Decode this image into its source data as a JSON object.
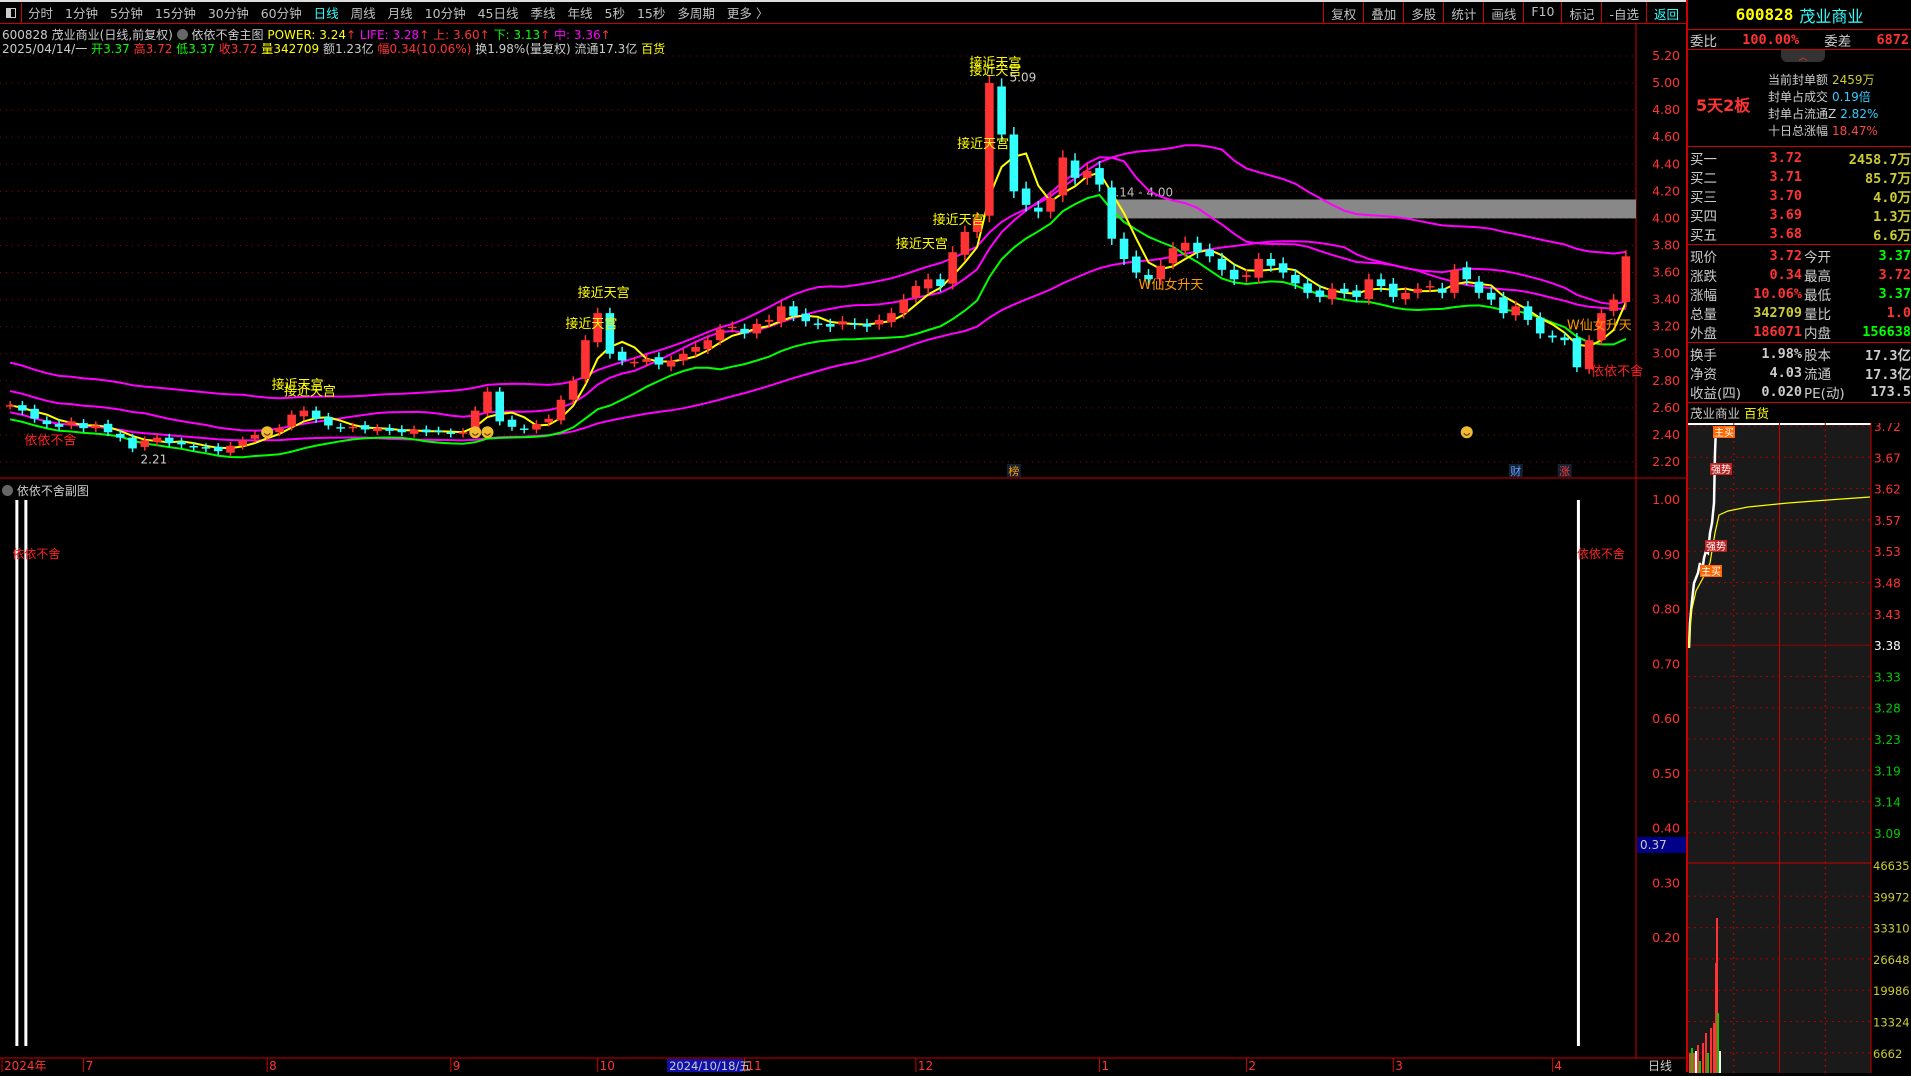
{
  "toolbar": {
    "periods": [
      "分时",
      "1分钟",
      "5分钟",
      "15分钟",
      "30分钟",
      "60分钟",
      "日线",
      "周线",
      "月线",
      "10分钟",
      "45日线",
      "季线",
      "年线",
      "5秒",
      "15秒",
      "多周期",
      "更多 〉"
    ],
    "active": "日线",
    "tools": [
      "复权",
      "叠加",
      "多股",
      "统计",
      "画线",
      "F10",
      "标记",
      "-自选",
      "返回"
    ]
  },
  "header": {
    "code": "600828",
    "name": "茂业商业(日线,前复权)",
    "indicator": "依依不舍主图",
    "power": "POWER: 3.24",
    "life": "LIFE: 3.28",
    "up": "上: 3.60",
    "down": "下: 3.13",
    "mid": "中: 3.36",
    "date": "2025/04/14/一",
    "open_l": "开",
    "open": "3.37",
    "high_l": "高",
    "high": "3.72",
    "low_l": "低",
    "low": "3.37",
    "close_l": "收",
    "close": "3.72",
    "vol_l": "量",
    "vol": "342709",
    "amt": "额1.23亿",
    "chg_l": "幅",
    "chg": "0.34(10.06%)",
    "turn": "换1.98%(量复权)",
    "float": "流通17.3亿",
    "sector": "百货"
  },
  "chart_data": {
    "type": "candlestick",
    "closes": [
      2.62,
      2.58,
      2.52,
      2.48,
      2.46,
      2.5,
      2.45,
      2.47,
      2.42,
      2.38,
      2.3,
      2.36,
      2.38,
      2.34,
      2.33,
      2.31,
      2.3,
      2.28,
      2.32,
      2.36,
      2.4,
      2.42,
      2.45,
      2.55,
      2.58,
      2.52,
      2.47,
      2.45,
      2.46,
      2.44,
      2.45,
      2.43,
      2.42,
      2.44,
      2.42,
      2.43,
      2.41,
      2.42,
      2.58,
      2.72,
      2.5,
      2.46,
      2.44,
      2.48,
      2.52,
      2.66,
      2.8,
      3.1,
      3.3,
      3.0,
      2.95,
      2.94,
      2.96,
      2.92,
      2.95,
      3.0,
      3.05,
      3.1,
      3.18,
      3.2,
      3.15,
      3.22,
      3.25,
      3.35,
      3.28,
      3.24,
      3.22,
      3.2,
      3.24,
      3.22,
      3.2,
      3.25,
      3.3,
      3.4,
      3.5,
      3.55,
      3.5,
      3.75,
      3.9,
      4.0,
      5.0,
      4.62,
      4.2,
      4.1,
      4.05,
      4.15,
      4.45,
      4.3,
      4.35,
      4.25,
      3.85,
      3.7,
      3.6,
      3.55,
      3.65,
      3.78,
      3.82,
      3.75,
      3.72,
      3.62,
      3.55,
      3.58,
      3.7,
      3.65,
      3.6,
      3.52,
      3.45,
      3.42,
      3.48,
      3.45,
      3.42,
      3.55,
      3.5,
      3.42,
      3.45,
      3.48,
      3.5,
      3.45,
      3.62,
      3.55,
      3.45,
      3.4,
      3.3,
      3.35,
      3.25,
      3.15,
      3.12,
      3.1,
      2.9,
      3.1,
      3.3,
      3.4,
      3.72
    ],
    "ylim": [
      2.2,
      5.2
    ],
    "yticks": [
      "5.20",
      "5.00",
      "4.80",
      "4.60",
      "4.40",
      "4.20",
      "4.00",
      "3.80",
      "3.60",
      "3.40",
      "3.20",
      "3.00",
      "2.80",
      "2.60",
      "2.40",
      "2.20"
    ],
    "colors": {
      "up": "#ff3333",
      "down": "#33ffff",
      "ma": "#ffff00",
      "low": "#00ff00",
      "band": "#ff00ff"
    },
    "xticks": [
      {
        "label": "2024年",
        "bar": 0
      },
      {
        "label": "7",
        "bar": 6
      },
      {
        "label": "8",
        "bar": 21
      },
      {
        "label": "9",
        "bar": 36
      },
      {
        "label": "10",
        "bar": 48
      },
      {
        "label": "11",
        "bar": 60
      },
      {
        "label": "12",
        "bar": 74
      },
      {
        "label": "1",
        "bar": 89
      },
      {
        "label": "2",
        "bar": 101
      },
      {
        "label": "3",
        "bar": 113
      },
      {
        "label": "4",
        "bar": 126
      }
    ],
    "cursor_date": "2024/10/18/五",
    "annotations": [
      {
        "t": "接近天宫",
        "bar": 48,
        "p": 3.42
      },
      {
        "t": "接近天宫",
        "bar": 47,
        "p": 3.19
      },
      {
        "t": "接近天宫",
        "bar": 23,
        "p": 2.74
      },
      {
        "t": "接近天宫",
        "bar": 24,
        "p": 2.69
      },
      {
        "t": "接近天宫",
        "bar": 74,
        "p": 3.78
      },
      {
        "t": "接近天宫",
        "bar": 77,
        "p": 3.96
      },
      {
        "t": "接近天宫",
        "bar": 79,
        "p": 4.52
      },
      {
        "t": "接近天宫",
        "bar": 80,
        "p": 5.12
      },
      {
        "t": "接近天宫",
        "bar": 80,
        "p": 5.06
      }
    ],
    "w_labels": [
      {
        "t": "W仙女升天",
        "bar": 93,
        "p": 3.48
      },
      {
        "t": "W仙女升天",
        "bar": 128,
        "p": 3.18
      }
    ],
    "yiyi_labels": [
      {
        "t": "依依不舍",
        "bar": 1,
        "p": 2.33
      },
      {
        "t": "依依不舍",
        "bar": 129,
        "p": 2.84
      }
    ],
    "price_labels": [
      {
        "t": "5.09",
        "bar": 81,
        "p": 5.04
      },
      {
        "t": "2.21",
        "bar": 10,
        "p": 2.22
      }
    ],
    "zone": {
      "label": "4.14 - 4.00",
      "from": 4.0,
      "to": 4.14,
      "bar": 90
    },
    "smileys": [
      21,
      38,
      39,
      119
    ],
    "markers": [
      {
        "t": "榜",
        "bar": 82,
        "color": "#f90"
      },
      {
        "t": "财",
        "bar": 123,
        "color": "#69f"
      },
      {
        "t": "涨",
        "bar": 127,
        "color": "#f33"
      }
    ]
  },
  "sub": {
    "title": "依依不舍副图",
    "yticks": [
      "1.00",
      "0.90",
      "0.80",
      "0.70",
      "0.60",
      "0.50",
      "0.40",
      "0.30",
      "0.20"
    ],
    "cursor": "0.37",
    "signal": "依依不舍"
  },
  "axis_mode": "日线",
  "panel": {
    "code": "600828",
    "name": "茂业商业",
    "wb_l": "委比",
    "wb": "100.00%",
    "wc_l": "委差",
    "wc": "6872",
    "board": "5天2板",
    "seal": [
      {
        "k": "当前封单额",
        "v": "2459万",
        "c": "#cc3"
      },
      {
        "k": "封单占成交",
        "v": "0.19倍",
        "c": "#3cf"
      },
      {
        "k": "封单占流通Z",
        "v": "2.82%",
        "c": "#3cf"
      },
      {
        "k": "十日总涨幅",
        "v": "18.47%",
        "c": "#f44"
      }
    ],
    "bids": [
      {
        "k": "买一",
        "p": "3.72",
        "v": "2458.7万"
      },
      {
        "k": "买二",
        "p": "3.71",
        "v": "85.7万"
      },
      {
        "k": "买三",
        "p": "3.70",
        "v": "4.0万"
      },
      {
        "k": "买四",
        "p": "3.69",
        "v": "1.3万"
      },
      {
        "k": "买五",
        "p": "3.68",
        "v": "6.6万"
      }
    ],
    "quote": [
      {
        "a": "现价",
        "av": "3.72",
        "ac": "#f33",
        "b": "今开",
        "bv": "3.37",
        "bc": "#0f0"
      },
      {
        "a": "涨跌",
        "av": "0.34",
        "ac": "#f33",
        "b": "最高",
        "bv": "3.72",
        "bc": "#f33"
      },
      {
        "a": "涨幅",
        "av": "10.06%",
        "ac": "#f33",
        "b": "最低",
        "bv": "3.37",
        "bc": "#0f0"
      },
      {
        "a": "总量",
        "av": "342709",
        "ac": "#cc3",
        "b": "量比",
        "bv": "1.0",
        "bc": "#f33"
      },
      {
        "a": "外盘",
        "av": "186071",
        "ac": "#f33",
        "b": "内盘",
        "bv": "156638",
        "bc": "#0f0"
      }
    ],
    "fund": [
      {
        "a": "换手",
        "av": "1.98%",
        "b": "股本",
        "bv": "17.3亿"
      },
      {
        "a": "净资",
        "av": "4.03",
        "b": "流通",
        "bv": "17.3亿"
      },
      {
        "a": "收益(四)",
        "av": "0.020",
        "b": "PE(动)",
        "bv": "173.5"
      }
    ],
    "intraday": {
      "name": "茂业商业",
      "sector": "百货",
      "price_ticks": [
        "3.72",
        "3.67",
        "3.62",
        "3.57",
        "3.53",
        "3.48",
        "3.43",
        "3.38",
        "3.33",
        "3.28",
        "3.23",
        "3.19",
        "3.14",
        "3.09"
      ],
      "vol_ticks": [
        "46635",
        "39972",
        "33310",
        "26648",
        "19986",
        "13324",
        "6662"
      ],
      "tags": [
        "主买",
        "强势",
        "强势",
        "主买"
      ]
    }
  }
}
